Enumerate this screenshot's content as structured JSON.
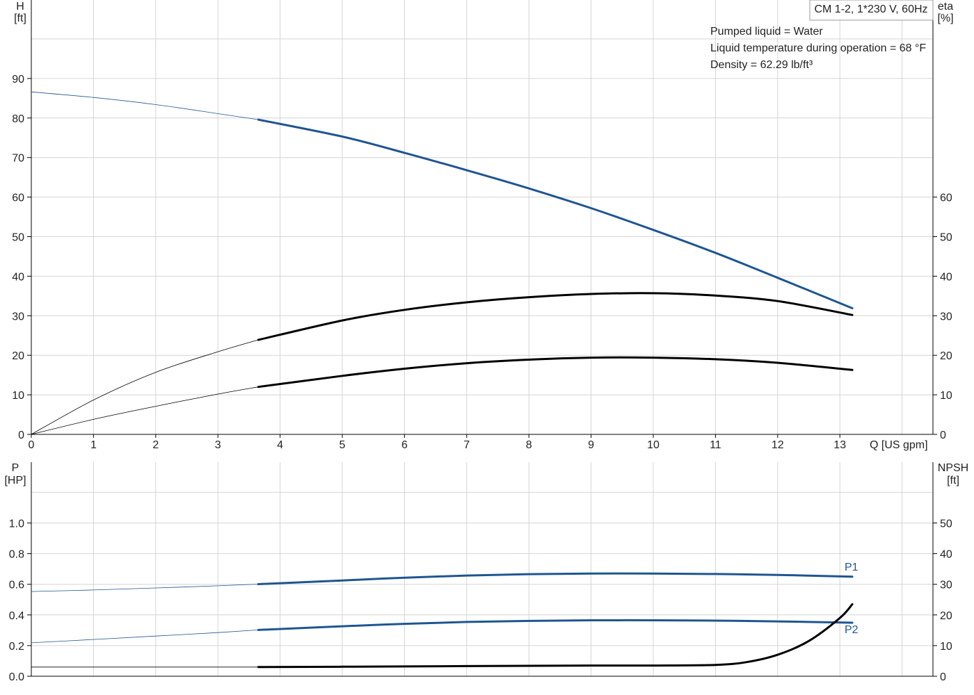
{
  "title_box": "CM 1-2, 1*230 V, 60Hz",
  "info": {
    "pumped_liquid": "Pumped liquid = Water",
    "liquid_temperature": "Liquid temperature during operation = 68 °F",
    "density": "Density = 62.29 lb/ft³"
  },
  "colors": {
    "blue": "#1f5591",
    "black": "#000000",
    "grid": "#d4d4d4"
  },
  "chart_data": [
    {
      "type": "line",
      "panel": "top",
      "xlabel": "Q [US gpm]",
      "ylabel_left": [
        "H",
        "[ft]"
      ],
      "ylabel_right": [
        "eta",
        "[%]"
      ],
      "xlim": [
        0,
        14
      ],
      "ylim_left": [
        0,
        90
      ],
      "ylim_right": [
        0,
        60
      ],
      "x_ticks": [
        "0",
        "1",
        "2",
        "3",
        "4",
        "5",
        "6",
        "7",
        "8",
        "9",
        "10",
        "11",
        "12",
        "13"
      ],
      "y_ticks_left": [
        "0",
        "10",
        "20",
        "30",
        "40",
        "50",
        "60",
        "70",
        "80",
        "90"
      ],
      "y_ticks_right": [
        "0",
        "10",
        "20",
        "30",
        "40",
        "50",
        "60"
      ],
      "grid": true,
      "series": [
        {
          "axis": "left",
          "color": "blue",
          "operating_range": [
            3.65,
            13.2
          ],
          "x": [
            0,
            1,
            2,
            3,
            3.65,
            5,
            6,
            7,
            8,
            9,
            10,
            11,
            12,
            13.2
          ],
          "y": [
            86.6,
            85.2,
            83.4,
            81.1,
            79.6,
            75.3,
            71.2,
            66.8,
            62.2,
            57.2,
            51.7,
            45.9,
            39.6,
            31.9
          ]
        },
        {
          "axis": "right",
          "color": "black",
          "operating_range": [
            3.65,
            13.2
          ],
          "x": [
            0,
            1,
            2,
            3,
            3.65,
            5,
            6,
            7,
            8,
            9,
            10,
            11,
            12,
            13.2
          ],
          "y": [
            0,
            8.7,
            15.7,
            20.9,
            23.9,
            28.8,
            31.5,
            33.4,
            34.7,
            35.5,
            35.7,
            35.1,
            33.7,
            30.2
          ]
        },
        {
          "axis": "left",
          "color": "black",
          "operating_range": [
            3.65,
            13.2
          ],
          "x": [
            0,
            1,
            2,
            3,
            3.65,
            5,
            6,
            7,
            8,
            9,
            10,
            11,
            12,
            13.2
          ],
          "y": [
            0,
            3.8,
            7.1,
            10.2,
            12.0,
            14.8,
            16.6,
            18.0,
            18.9,
            19.4,
            19.4,
            19.0,
            18.1,
            16.3
          ]
        }
      ]
    },
    {
      "type": "line",
      "panel": "bottom",
      "ylabel_left": [
        "P",
        "[HP]"
      ],
      "ylabel_right": [
        "NPSH",
        "[ft]"
      ],
      "xlim": [
        0,
        14
      ],
      "ylim_left": [
        0,
        1.2
      ],
      "ylim_right": [
        0,
        60
      ],
      "y_ticks_left": [
        "0.0",
        "0.2",
        "0.4",
        "0.6",
        "0.8",
        "1.0"
      ],
      "y_ticks_right": [
        "0",
        "10",
        "20",
        "30",
        "40",
        "50"
      ],
      "grid": true,
      "series": [
        {
          "name": "P1",
          "axis": "left",
          "color": "blue",
          "operating_range": [
            3.65,
            13.2
          ],
          "x": [
            0,
            1,
            2,
            3,
            3.65,
            5,
            6,
            7,
            8,
            9,
            10,
            11,
            12,
            13.2
          ],
          "y": [
            0.553,
            0.563,
            0.576,
            0.59,
            0.601,
            0.625,
            0.643,
            0.657,
            0.666,
            0.67,
            0.67,
            0.667,
            0.661,
            0.65
          ]
        },
        {
          "name": "P2",
          "axis": "left",
          "color": "blue",
          "operating_range": [
            3.65,
            13.2
          ],
          "x": [
            0,
            1,
            2,
            3,
            3.65,
            5,
            6,
            7,
            8,
            9,
            10,
            11,
            12,
            13.2
          ],
          "y": [
            0.218,
            0.24,
            0.262,
            0.285,
            0.302,
            0.326,
            0.342,
            0.354,
            0.361,
            0.365,
            0.365,
            0.363,
            0.358,
            0.349
          ]
        },
        {
          "axis": "right",
          "color": "black",
          "operating_range": [
            3.65,
            13.2
          ],
          "x": [
            0,
            3.65,
            5,
            7,
            9,
            10,
            11,
            11.5,
            12,
            12.5,
            13,
            13.2
          ],
          "y": [
            3.0,
            3.0,
            3.1,
            3.3,
            3.5,
            3.5,
            3.7,
            4.6,
            7.0,
            11.5,
            19.0,
            23.5
          ]
        }
      ]
    }
  ]
}
